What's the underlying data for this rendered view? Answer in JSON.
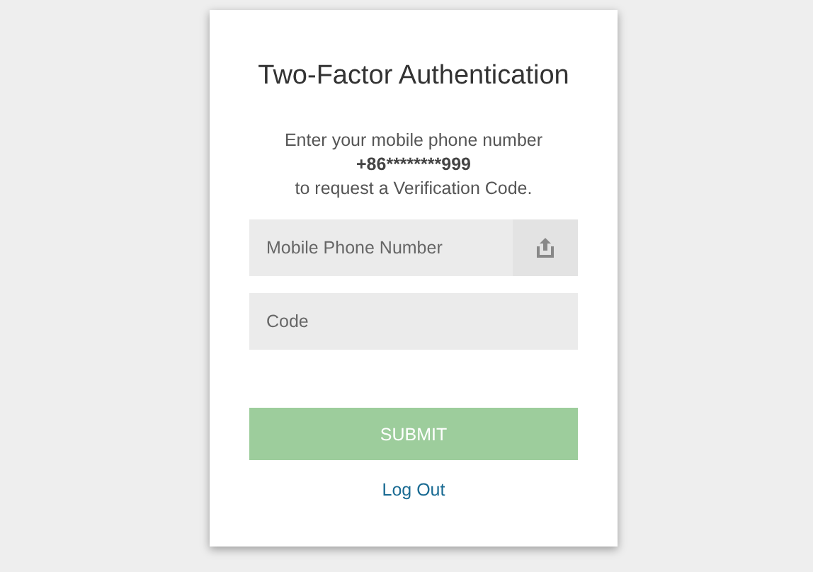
{
  "title": "Two-Factor Authentication",
  "description": [
    {
      "text": "Enter your mobile phone number",
      "bold": false
    },
    {
      "text": "+86********999",
      "bold": true
    },
    {
      "text": "to request a Verification Code.",
      "bold": false
    }
  ],
  "fields": [
    {
      "placeholder": "Mobile Phone Number",
      "kind": "send"
    },
    {
      "placeholder": "Code",
      "kind": "plain"
    }
  ],
  "submit": {
    "label": "SUBMIT",
    "disabled": true
  },
  "link": "Log Out"
}
